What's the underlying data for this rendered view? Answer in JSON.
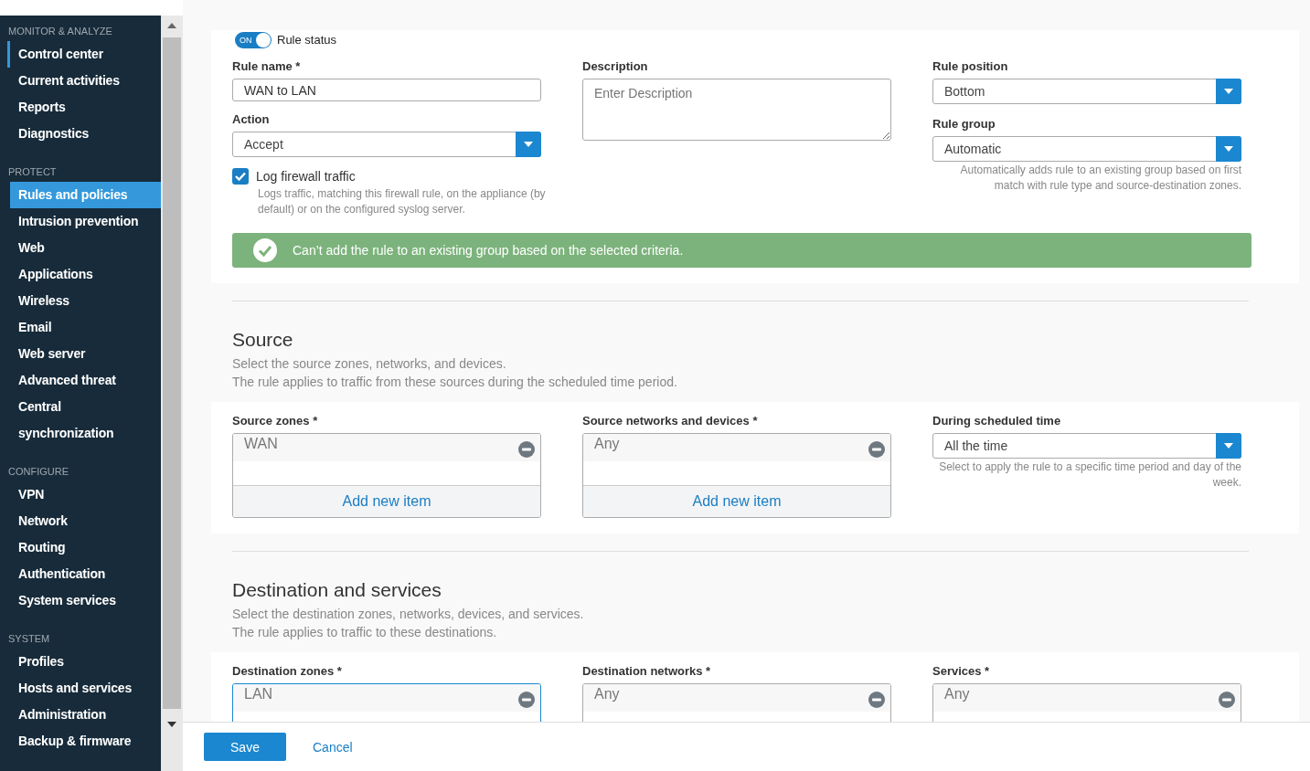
{
  "sidebar": {
    "sections": [
      {
        "heading": "MONITOR & ANALYZE",
        "items": [
          {
            "label": "Control center",
            "selected": false,
            "current": true
          },
          {
            "label": "Current activities",
            "selected": false,
            "current": false
          },
          {
            "label": "Reports",
            "selected": false,
            "current": false
          },
          {
            "label": "Diagnostics",
            "selected": false,
            "current": false
          }
        ]
      },
      {
        "heading": "PROTECT",
        "items": [
          {
            "label": "Rules and policies",
            "selected": true,
            "current": false
          },
          {
            "label": "Intrusion prevention",
            "selected": false,
            "current": false
          },
          {
            "label": "Web",
            "selected": false,
            "current": false
          },
          {
            "label": "Applications",
            "selected": false,
            "current": false
          },
          {
            "label": "Wireless",
            "selected": false,
            "current": false
          },
          {
            "label": "Email",
            "selected": false,
            "current": false
          },
          {
            "label": "Web server",
            "selected": false,
            "current": false
          },
          {
            "label": "Advanced threat",
            "selected": false,
            "current": false
          },
          {
            "label": "Central synchronization",
            "selected": false,
            "current": false
          }
        ]
      },
      {
        "heading": "CONFIGURE",
        "items": [
          {
            "label": "VPN",
            "selected": false,
            "current": false
          },
          {
            "label": "Network",
            "selected": false,
            "current": false
          },
          {
            "label": "Routing",
            "selected": false,
            "current": false
          },
          {
            "label": "Authentication",
            "selected": false,
            "current": false
          },
          {
            "label": "System services",
            "selected": false,
            "current": false
          }
        ]
      },
      {
        "heading": "SYSTEM",
        "items": [
          {
            "label": "Profiles",
            "selected": false,
            "current": false
          },
          {
            "label": "Hosts and services",
            "selected": false,
            "current": false
          },
          {
            "label": "Administration",
            "selected": false,
            "current": false
          },
          {
            "label": "Backup & firmware",
            "selected": false,
            "current": false
          }
        ]
      }
    ]
  },
  "rule": {
    "status": {
      "label": "Rule status",
      "on": true,
      "on_text": "ON"
    },
    "name": {
      "label": "Rule name *",
      "value": "WAN to LAN"
    },
    "action": {
      "label": "Action",
      "value": "Accept"
    },
    "log": {
      "label": "Log firewall traffic",
      "checked": true,
      "help": "Logs traffic, matching this firewall rule, on the appliance (by default) or on the configured syslog server."
    },
    "description": {
      "label": "Description",
      "placeholder": "Enter Description"
    },
    "position": {
      "label": "Rule position",
      "value": "Bottom"
    },
    "group": {
      "label": "Rule group",
      "value": "Automatic",
      "help": "Automatically adds rule to an existing group based on first match with rule type and source-destination zones."
    },
    "banner": {
      "text": "Can’t add the rule to an existing group based on the selected criteria."
    }
  },
  "sections": [
    {
      "title": "Source",
      "lines": [
        "Select the source zones, networks, and devices.",
        "The rule applies to traffic from these sources during the scheduled time period."
      ],
      "fields": [
        {
          "kind": "list",
          "label": "Source zones *",
          "items": [
            "WAN"
          ],
          "add": "Add new item",
          "focused": false
        },
        {
          "kind": "list",
          "label": "Source networks and devices *",
          "items": [
            "Any"
          ],
          "add": "Add new item",
          "focused": false
        },
        {
          "kind": "select",
          "label": "During scheduled time",
          "value": "All the time",
          "help": "Select to apply the rule to a specific time period and day of the week."
        }
      ]
    },
    {
      "title": "Destination and services",
      "lines": [
        "Select the destination zones, networks, devices, and services.",
        "The rule applies to traffic to these destinations."
      ],
      "fields": [
        {
          "kind": "list",
          "label": "Destination zones *",
          "items": [
            "LAN"
          ],
          "focused": true
        },
        {
          "kind": "list",
          "label": "Destination networks *",
          "items": [
            "Any"
          ],
          "focused": false
        },
        {
          "kind": "list",
          "label": "Services *",
          "items": [
            "Any"
          ],
          "focused": false
        }
      ]
    }
  ],
  "footer": {
    "save": "Save",
    "cancel": "Cancel"
  }
}
